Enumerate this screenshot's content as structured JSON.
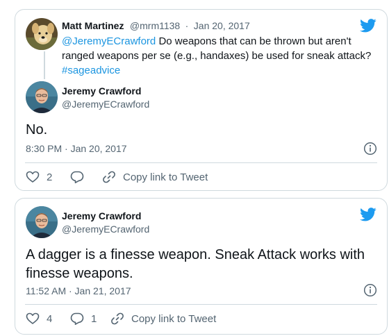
{
  "tweets": [
    {
      "reply": {
        "author_name": "Matt Martinez",
        "author_handle": "@mrm1138",
        "separator": "·",
        "date": "Jan 20, 2017",
        "mention": "@JeremyECrawford",
        "text_line1_rest": "Do weapons that can be thrown but aren't",
        "text_line2": "ranged weapons per se (e.g., handaxes) be used for sneak attack?",
        "hashtag": "#sageadvice"
      },
      "author_name": "Jeremy Crawford",
      "author_handle": "@JeremyECrawford",
      "text_line1": "No.",
      "text_line2": "",
      "timestamp": "8:30 PM · Jan 20, 2017",
      "likes": "2",
      "replies": "",
      "copy_link_label": "Copy link to Tweet"
    },
    {
      "author_name": "Jeremy Crawford",
      "author_handle": "@JeremyECrawford",
      "text_line1": "A dagger is a finesse weapon. Sneak Attack works with",
      "text_line2": "finesse weapons.",
      "timestamp": "11:52 AM · Jan 21, 2017",
      "likes": "4",
      "replies": "1",
      "copy_link_label": "Copy link to Tweet"
    }
  ],
  "colors": {
    "accent": "#1b95e0",
    "text": "#0f1419",
    "muted": "#536471",
    "border": "#cfd9de"
  },
  "icons": [
    "twitter-bird-icon",
    "info-icon",
    "heart-icon",
    "reply-icon",
    "link-icon"
  ]
}
